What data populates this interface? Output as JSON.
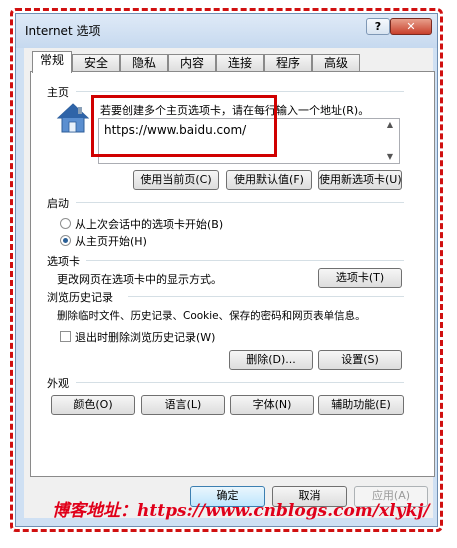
{
  "window": {
    "title": "Internet 选项",
    "help_label": "?",
    "close_label": "✕"
  },
  "tabs": [
    {
      "label": "常规",
      "active": true
    },
    {
      "label": "安全"
    },
    {
      "label": "隐私"
    },
    {
      "label": "内容"
    },
    {
      "label": "连接"
    },
    {
      "label": "程序"
    },
    {
      "label": "高级"
    }
  ],
  "home": {
    "section": "主页",
    "instruction": "若要创建多个主页选项卡，请在每行输入一个地址(R)。",
    "url": "https://www.baidu.com/",
    "icon": "house-icon",
    "buttons": [
      "使用当前页(C)",
      "使用默认值(F)",
      "使用新选项卡(U)"
    ]
  },
  "startup": {
    "section": "启动",
    "options": [
      "从上次会话中的选项卡开始(B)",
      "从主页开始(H)"
    ],
    "selected_index": 1
  },
  "tabs_section": {
    "section": "选项卡",
    "text": "更改网页在选项卡中的显示方式。",
    "button": "选项卡(T)"
  },
  "history": {
    "section": "浏览历史记录",
    "text": "删除临时文件、历史记录、Cookie、保存的密码和网页表单信息。",
    "checkbox": "退出时删除浏览历史记录(W)",
    "checked": false,
    "delete_button": "删除(D)...",
    "settings_button": "设置(S)"
  },
  "appearance": {
    "section": "外观",
    "buttons": [
      "颜色(O)",
      "语言(L)",
      "字体(N)",
      "辅助功能(E)"
    ]
  },
  "footer": {
    "ok": "确定",
    "cancel": "取消",
    "apply": "应用(A)"
  },
  "watermark": "博客地址：https://www.cnblogs.com/xlykj/",
  "colors": {
    "highlight_box": "#d00000",
    "watermark": "#e0001a"
  }
}
